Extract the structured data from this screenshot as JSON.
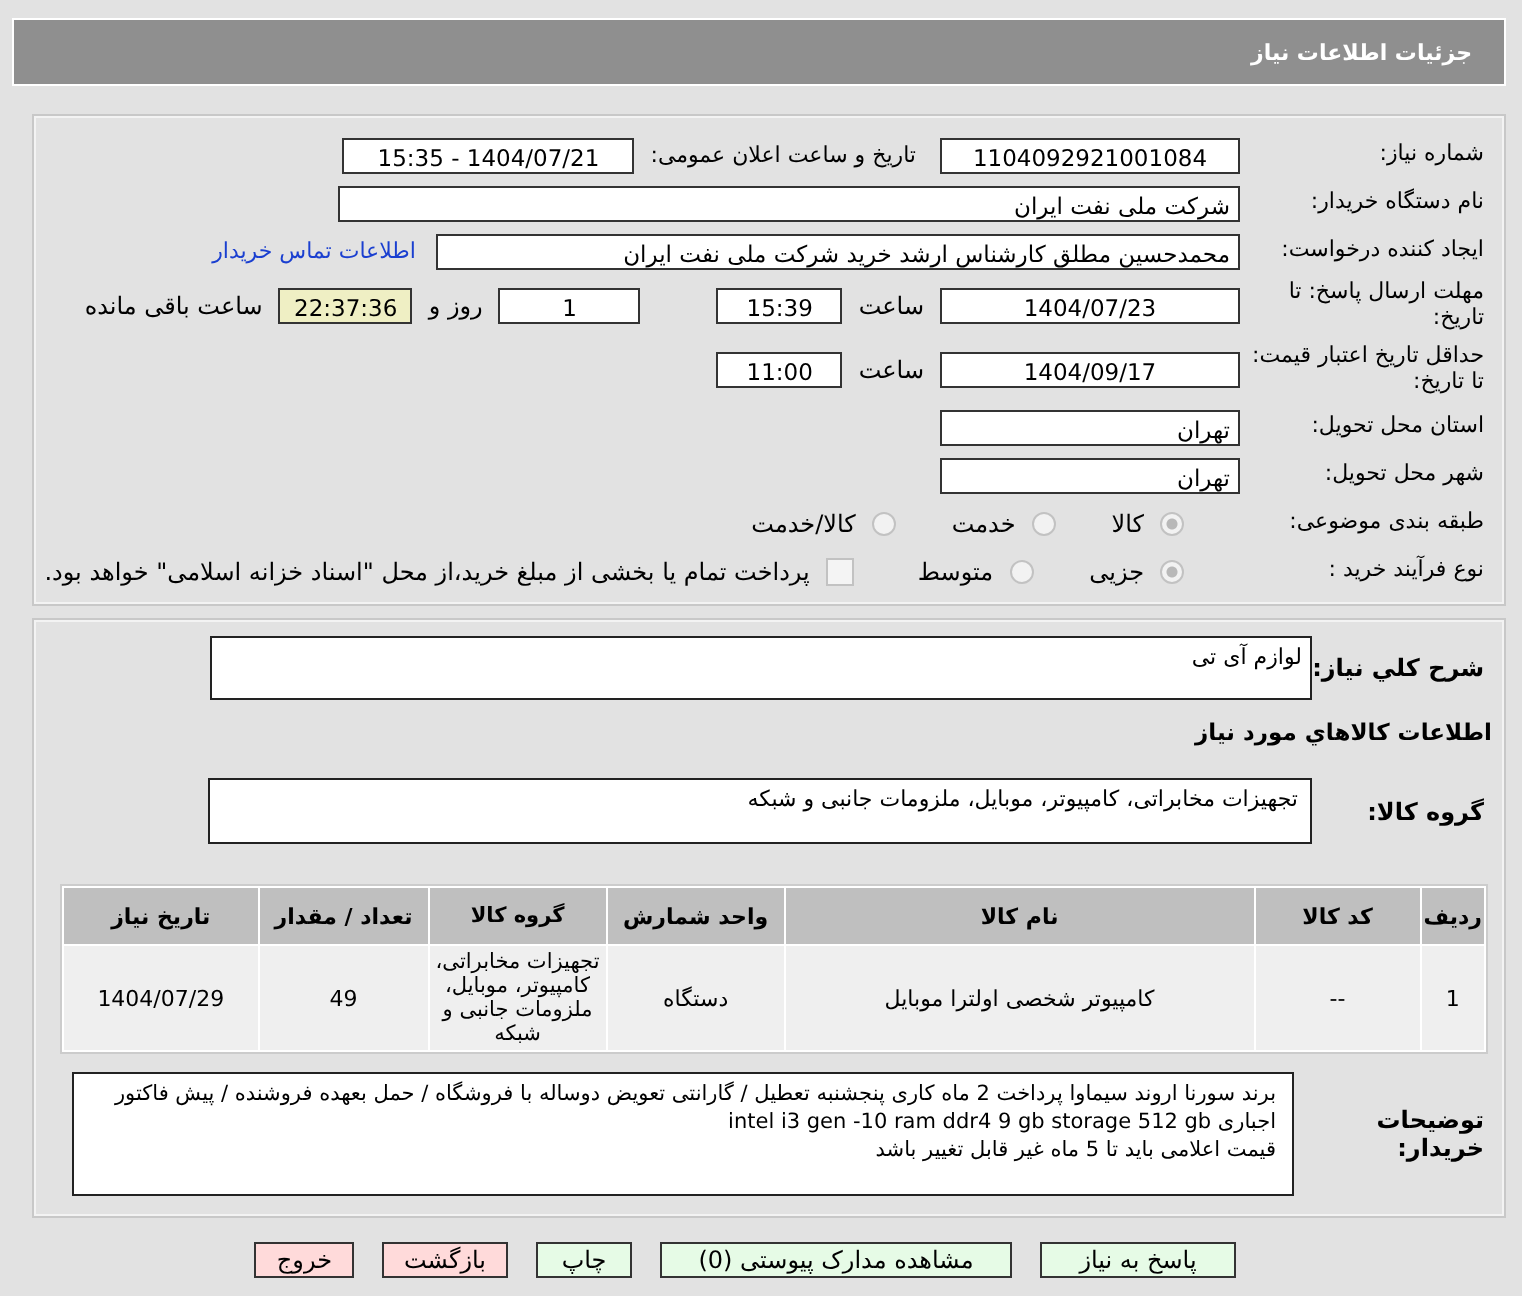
{
  "page_title": "جزئیات اطلاعات نیاز",
  "fields": {
    "need_number": {
      "label": "شماره نیاز:",
      "value": "1104092921001084"
    },
    "announce": {
      "label": "تاریخ و ساعت اعلان عمومی:",
      "value": "1404/07/21 - 15:35"
    },
    "buyer": {
      "label": "نام دستگاه خریدار:",
      "value": "شرکت ملی نفت ایران"
    },
    "creator": {
      "label": "ایجاد کننده درخواست:",
      "value": "محمدحسین مطلق کارشناس ارشد خرید شرکت ملی نفت ایران",
      "link": "اطلاعات تماس خریدار"
    },
    "deadline": {
      "label": "مهلت ارسال پاسخ: تا تاریخ:",
      "date": "1404/07/23",
      "time_label": "ساعت",
      "time": "15:39",
      "days": "1",
      "days_label": "روز و",
      "remaining": "22:37:36",
      "remaining_label": "ساعت باقی مانده"
    },
    "validity": {
      "label": "حداقل تاریخ اعتبار قیمت: تا تاریخ:",
      "date": "1404/09/17",
      "time_label": "ساعت",
      "time": "11:00"
    },
    "province": {
      "label": "استان محل تحویل:",
      "value": "تهران"
    },
    "city": {
      "label": "شهر محل تحویل:",
      "value": "تهران"
    }
  },
  "category": {
    "label": "طبقه بندی موضوعی:",
    "options": [
      {
        "label": "کالا",
        "selected": true
      },
      {
        "label": "خدمت",
        "selected": false
      },
      {
        "label": "کالا/خدمت",
        "selected": false
      }
    ]
  },
  "process": {
    "label": "نوع فرآیند خرید :",
    "options": [
      {
        "label": "جزیی",
        "selected": true
      },
      {
        "label": "متوسط",
        "selected": false
      }
    ],
    "payment": {
      "label": "پرداخت تمام یا بخشی از مبلغ خرید،از محل \"اسناد خزانه اسلامی\" خواهد بود.",
      "checked": false
    }
  },
  "summary": {
    "label": "شرح کلي نياز:",
    "value": "لوازم آی تی"
  },
  "goods_heading": "اطلاعات کالاهاي مورد نياز",
  "goods_group": {
    "label": "گروه کالا:",
    "value": "تجهیزات مخابراتی، کامپیوتر، موبایل، ملزومات جانبی و شبکه"
  },
  "table": {
    "columns": [
      "ردیف",
      "کد کالا",
      "نام کالا",
      "واحد شمارش",
      "گروه کالا",
      "تعداد / مقدار",
      "تاریخ نیاز"
    ],
    "rows": [
      [
        "1",
        "--",
        "کامپیوتر شخصی اولترا موبایل",
        "دستگاه",
        "تجهیزات مخابراتی، کامپیوتر، موبایل، ملزومات جانبی و شبکه",
        "49",
        "1404/07/29"
      ]
    ]
  },
  "notes": {
    "label": "توضیحات خریدار:",
    "lines": [
      "برند سورنا اروند سیماوا پرداخت 2 ماه کاری پنجشنبه تعطیل / گارانتی تعویض دوساله با فروشگاه / حمل بعهده فروشنده / پیش فاکتور اجباری  intel i3 gen -10  ram ddr4 9 gb storage 512 gb",
      "قیمت اعلامی باید تا 5 ماه غیر قابل تغییر باشد"
    ]
  },
  "buttons": [
    {
      "label": "پاسخ به نیاز",
      "kind": "primary"
    },
    {
      "label": "مشاهده مدارک پیوستی (0)",
      "kind": "primary"
    },
    {
      "label": "چاپ",
      "kind": "primary"
    },
    {
      "label": "بازگشت",
      "kind": "danger"
    },
    {
      "label": "خروج",
      "kind": "danger"
    }
  ]
}
